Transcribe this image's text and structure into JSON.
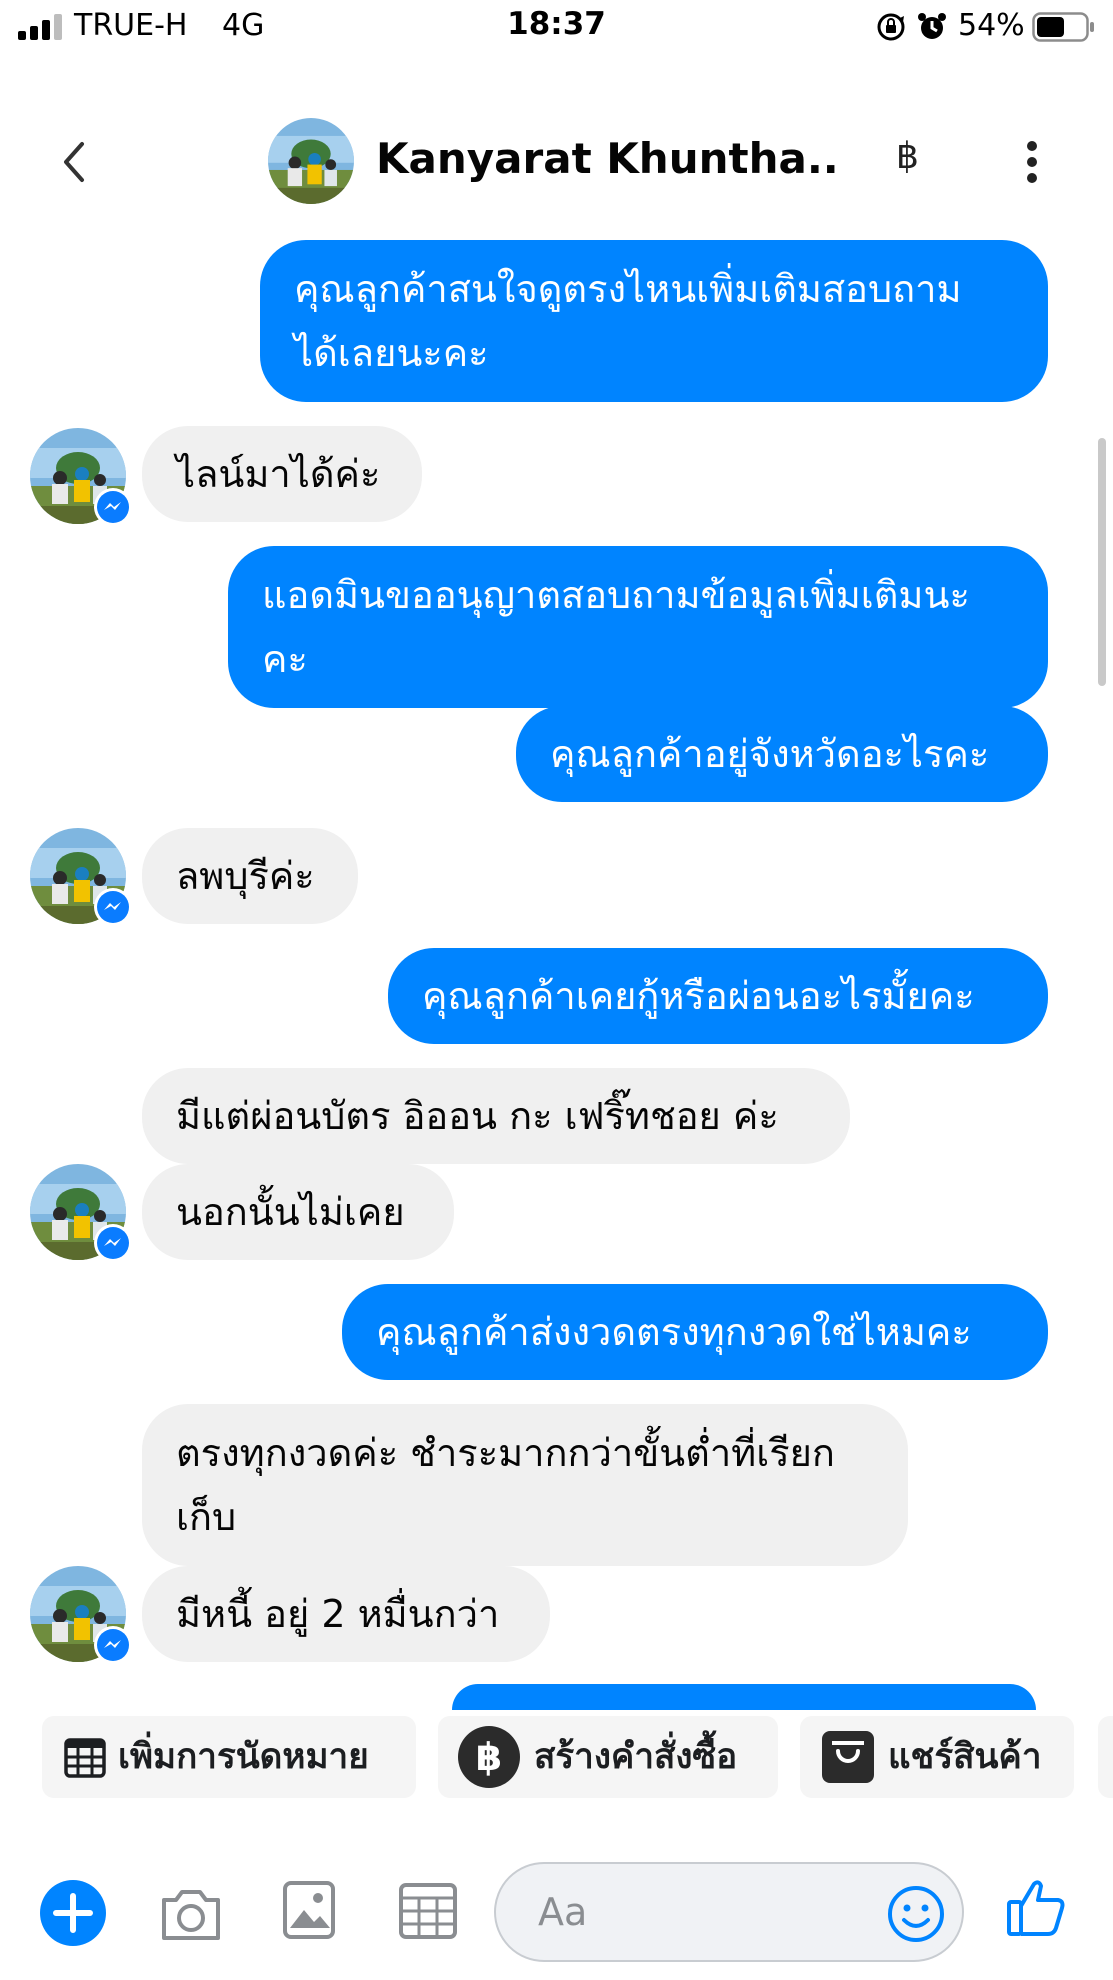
{
  "status_bar": {
    "carrier": "TRUE-H",
    "network": "4G",
    "time": "18:37",
    "battery": "54%",
    "battery_level": 0.54
  },
  "header": {
    "contact_name": "Kanyarat Khuntha...",
    "baht_icon": "฿"
  },
  "messages": [
    {
      "direction": "out",
      "text": "คุณลูกค้าสนใจดูตรงไหนเพิ่มเติมสอบถาม\nได้เลยนะคะ"
    },
    {
      "direction": "in",
      "text": "ไลน์มาได้ค่ะ"
    },
    {
      "direction": "out",
      "text": "แอดมินขออนุญาตสอบถามข้อมูลเพิ่มเติมนะ\nคะ"
    },
    {
      "direction": "out",
      "text": "คุณลูกค้าอยู่จังหวัดอะไรคะ"
    },
    {
      "direction": "in",
      "text": "ลพบุรีค่ะ"
    },
    {
      "direction": "out",
      "text": "คุณลูกค้าเคยกู้หรือผ่อนอะไรมั้ยคะ"
    },
    {
      "direction": "in",
      "text": "มีแต่ผ่อนบัตร อิออน กะ เฟริ๊ทชอย ค่ะ"
    },
    {
      "direction": "in",
      "text": "นอกนั้นไม่เคย"
    },
    {
      "direction": "out",
      "text": "คุณลูกค้าส่งงวดตรงทุกงวดใช่ไหมคะ"
    },
    {
      "direction": "in",
      "text": "ตรงทุกงวดค่ะ ชำระมากกว่าขั้นต่ำที่เรียก\nเก็บ"
    },
    {
      "direction": "in",
      "text": "มีหนี้ อยู่ 2 หมื่นกว่า"
    }
  ],
  "quick_actions": [
    {
      "label": "เพิ่มการนัดหมาย",
      "icon": "calendar-grid-icon"
    },
    {
      "label": "สร้างคำสั่งซื้อ",
      "icon": "baht-circle-icon"
    },
    {
      "label": "แชร์สินค้า",
      "icon": "shopping-bag-icon"
    }
  ],
  "composer": {
    "placeholder": "Aa"
  },
  "colors": {
    "outgoing_bubble": "#0084ff",
    "incoming_bubble": "#f0f0f0",
    "accent": "#0084ff"
  }
}
